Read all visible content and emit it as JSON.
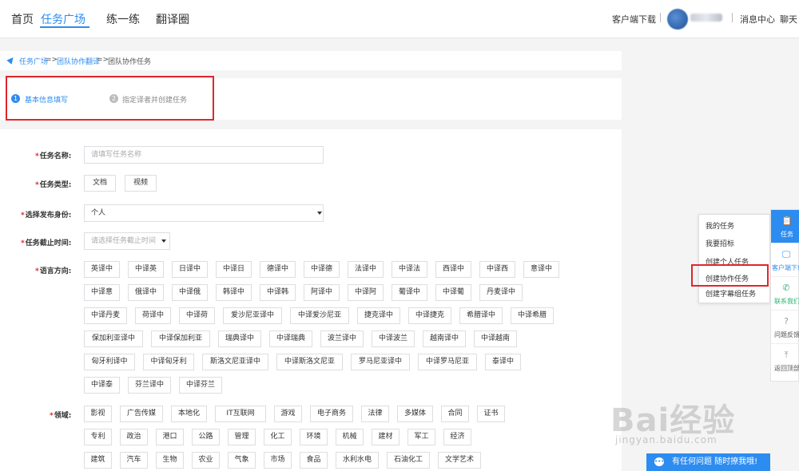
{
  "nav": {
    "items": [
      "首页",
      "任务广场",
      "练一练",
      "翻译圈"
    ],
    "active_index": 1
  },
  "header_right": {
    "download": "客户端下载",
    "messages": "消息中心",
    "chat": "聊天"
  },
  "breadcrumb": {
    "items": [
      "任务广场",
      "团队协作翻译",
      "团队协作任务"
    ],
    "separator": "=>"
  },
  "steps": [
    {
      "num": "1",
      "label": "基本信息填写",
      "active": true
    },
    {
      "num": "2",
      "label": "指定译者并创建任务",
      "active": false
    }
  ],
  "form": {
    "task_name": {
      "label": "任务名称:",
      "placeholder": "请填写任务名称"
    },
    "task_type": {
      "label": "任务类型:",
      "options": [
        "文档",
        "视频"
      ]
    },
    "identity": {
      "label": "选择发布身份:",
      "value": "个人"
    },
    "deadline": {
      "label": "任务截止时间:",
      "placeholder": "请选择任务截止时间"
    },
    "language": {
      "label": "语言方向:",
      "rows": [
        [
          "英译中",
          "中译英",
          "日译中",
          "中译日",
          "德译中",
          "中译德",
          "法译中",
          "中译法",
          "西译中",
          "中译西",
          "意译中"
        ],
        [
          "中译意",
          "俄译中",
          "中译俄",
          "韩译中",
          "中译韩",
          "阿译中",
          "中译阿",
          "葡译中",
          "中译葡",
          "丹麦译中"
        ],
        [
          "中译丹麦",
          "荷译中",
          "中译荷",
          "爱沙尼亚译中",
          "中译爱沙尼亚",
          "捷克译中",
          "中译捷克",
          "希腊译中",
          "中译希腊"
        ],
        [
          "保加利亚译中",
          "中译保加利亚",
          "瑞典译中",
          "中译瑞典",
          "波兰译中",
          "中译波兰",
          "越南译中",
          "中译越南"
        ],
        [
          "匈牙利译中",
          "中译匈牙利",
          "斯洛文尼亚译中",
          "中译斯洛文尼亚",
          "罗马尼亚译中",
          "中译罗马尼亚",
          "泰译中"
        ],
        [
          "中译泰",
          "芬兰译中",
          "中译芬兰"
        ]
      ]
    },
    "domain": {
      "label": "领域:",
      "rows": [
        [
          "影视",
          "广告传媒",
          "本地化",
          "IT互联网",
          "游戏",
          "电子商务",
          "法律",
          "多媒体",
          "合同",
          "证书"
        ],
        [
          "专利",
          "政治",
          "港口",
          "公路",
          "管理",
          "化工",
          "环境",
          "机械",
          "建材",
          "军工",
          "经济"
        ],
        [
          "建筑",
          "汽车",
          "生物",
          "农业",
          "气象",
          "市场",
          "食品",
          "水利水电",
          "石油化工",
          "文学艺术"
        ]
      ]
    }
  },
  "side_menu": [
    "我的任务",
    "我要招标",
    "创建个人任务",
    "创建协作任务",
    "创建字幕组任务"
  ],
  "sidebar": [
    {
      "icon": "clipboard-icon",
      "glyph": "📋",
      "label": "任务",
      "active": true
    },
    {
      "icon": "monitor-icon",
      "glyph": "🖵",
      "label": "客户端下载",
      "active": false
    },
    {
      "icon": "phone-icon",
      "glyph": "✆",
      "label": "联系我们",
      "active": false
    },
    {
      "icon": "question-icon",
      "glyph": "?",
      "label": "问题反馈",
      "active": false
    },
    {
      "icon": "top-icon",
      "glyph": "⤒",
      "label": "返回顶部",
      "active": false
    }
  ],
  "chat_bar": {
    "label": "有任何问题 随时撩我哦!"
  },
  "watermark": {
    "logo": "Bai经验",
    "url": "jingyan.baidu.com"
  },
  "colors": {
    "accent": "#2d8cf0",
    "highlight": "#e0262c",
    "step_inactive": "#bbbbbb"
  }
}
